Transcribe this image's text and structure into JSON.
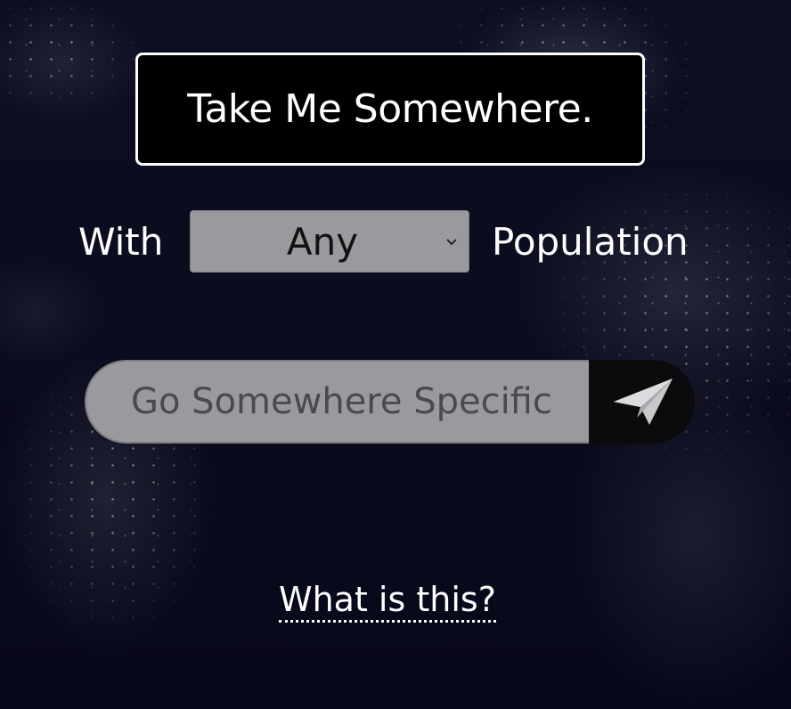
{
  "main": {
    "take_me_button_label": "Take Me Somewhere.",
    "population": {
      "prefix_label": "With",
      "selected_value": "Any",
      "suffix_label": "Population"
    },
    "search": {
      "placeholder": "Go Somewhere Specific",
      "value": ""
    },
    "send_icon": "paper-plane-icon",
    "what_is_this_link": "What is this?"
  },
  "colors": {
    "background": "#090a1a",
    "button_bg": "#000000",
    "button_border": "#ffffff",
    "field_bg": "#9a9a9e",
    "send_bg": "#0b0b0d",
    "text": "#ffffff"
  }
}
